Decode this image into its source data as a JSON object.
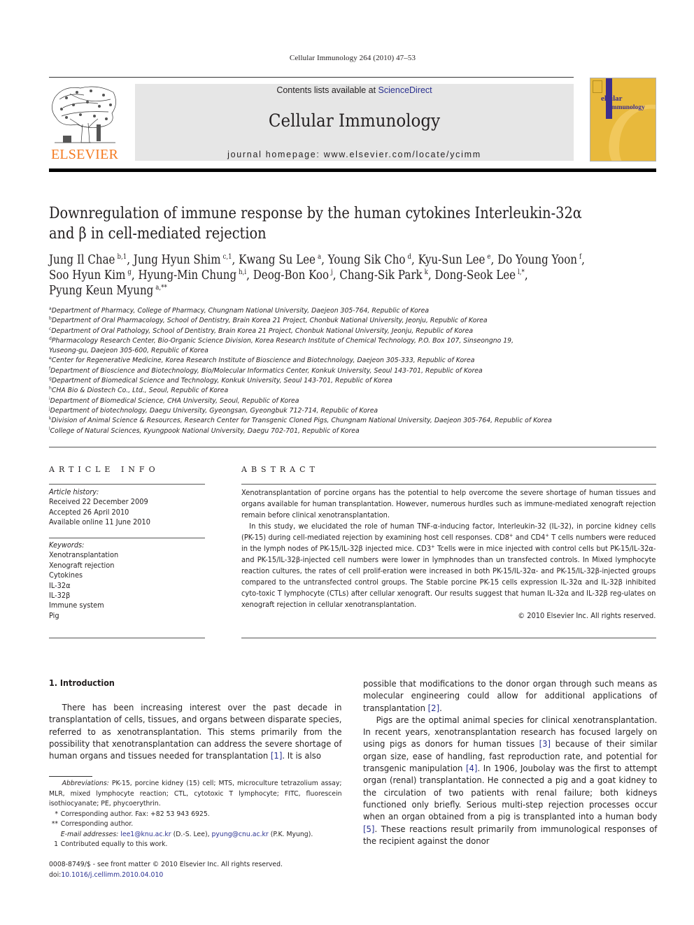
{
  "running_head": "Cellular Immunology 264 (2010) 47–53",
  "publisher": {
    "name": "ELSEVIER",
    "brand_color": "#f47a20"
  },
  "masthead": {
    "contents_prefix": "Contents lists available at ",
    "contents_link": "ScienceDirect",
    "journal_name": "Cellular Immunology",
    "homepage": "journal homepage: www.elsevier.com/locate/ycimm",
    "background": "#e6e6e6",
    "link_color": "#2a3190"
  },
  "cover": {
    "line1": "ellular",
    "line2": "Immunology",
    "big_letter": "C",
    "color": "#e8b93c",
    "accent": "#3c2f8e"
  },
  "article": {
    "title_line1": "Downregulation of immune response by the human cytokines Interleukin-32α",
    "title_line2": "and β in cell-mediated rejection",
    "authors": [
      {
        "name": "Jung Il Chae",
        "sup": "b,1"
      },
      {
        "name": "Jung Hyun Shim",
        "sup": "c,1"
      },
      {
        "name": "Kwang Su Lee",
        "sup": "a"
      },
      {
        "name": "Young Sik Cho",
        "sup": "d"
      },
      {
        "name": "Kyu-Sun Lee",
        "sup": "e"
      },
      {
        "name": "Do Young Yoon",
        "sup": "f"
      },
      {
        "name": "Soo Hyun Kim",
        "sup": "g"
      },
      {
        "name": "Hyung-Min Chung",
        "sup": "h,i"
      },
      {
        "name": "Deog-Bon Koo",
        "sup": "j"
      },
      {
        "name": "Chang-Sik Park",
        "sup": "k"
      },
      {
        "name": "Dong-Seok Lee",
        "sup": "l,*"
      },
      {
        "name": "Pyung Keun Myung",
        "sup": "a,**"
      }
    ],
    "affiliations": [
      {
        "key": "a",
        "text": "Department of Pharmacy, College of Pharmacy, Chungnam National University, Daejeon 305-764, Republic of Korea"
      },
      {
        "key": "b",
        "text": "Department of Oral Pharmacology, School of Dentistry, Brain Korea 21 Project, Chonbuk National University, Jeonju, Republic of Korea"
      },
      {
        "key": "c",
        "text": "Department of Oral Pathology, School of Dentistry, Brain Korea 21 Project, Chonbuk National University, Jeonju, Republic of Korea"
      },
      {
        "key": "d",
        "text": "Pharmacology Research Center, Bio-Organic Science Division, Korea Research Institute of Chemical Technology, P.O. Box 107, Sinseongno 19,",
        "cont": "Yuseong-gu, Daejeon 305-600, Republic of Korea"
      },
      {
        "key": "e",
        "text": "Center for Regenerative Medicine, Korea Research Institute of Bioscience and Biotechnology, Daejeon 305-333, Republic of Korea"
      },
      {
        "key": "f",
        "text": "Department of Bioscience and Biotechnology, Bio/Molecular Informatics Center, Konkuk University, Seoul 143-701, Republic of Korea"
      },
      {
        "key": "g",
        "text": "Department of Biomedical Science and Technology, Konkuk University, Seoul 143-701, Republic of Korea"
      },
      {
        "key": "h",
        "text": "CHA Bio & Diostech Co., Ltd., Seoul, Republic of Korea"
      },
      {
        "key": "i",
        "text": "Department of Biomedical Science, CHA University, Seoul, Republic of Korea"
      },
      {
        "key": "j",
        "text": "Department of biotechnology, Daegu University, Gyeongsan, Gyeongbuk 712-714, Republic of Korea"
      },
      {
        "key": "k",
        "text": "Division of Animal Science & Resources, Research Center for Transgenic Cloned Pigs, Chungnam National University, Daejeon 305-764, Republic of Korea"
      },
      {
        "key": "l",
        "text": "College of Natural Sciences, Kyungpook National University, Daegu 702-701, Republic of Korea"
      }
    ]
  },
  "article_info": {
    "heading": "ARTICLE INFO",
    "history_label": "Article history:",
    "history": [
      "Received 22 December 2009",
      "Accepted 26 April 2010",
      "Available online 11 June 2010"
    ],
    "keywords_label": "Keywords:",
    "keywords": [
      "Xenotransplantation",
      "Xenograft rejection",
      "Cytokines",
      "IL-32α",
      "IL-32β",
      "Immune system",
      "Pig"
    ]
  },
  "abstract": {
    "heading": "ABSTRACT",
    "p1": "Xenotransplantation of porcine organs has the potential to help overcome the severe shortage of human tissues and organs available for human transplantation. However, numerous hurdles such as immune-mediated xenograft rejection remain before clinical xenotransplantation.",
    "p2_a": "In this study, we elucidated the role of human TNF-α-inducing factor, Interleukin-32 (IL-32), in porcine kidney cells (PK-15) during cell-mediated rejection by examining host cell responses. CD8",
    "p2_b": " and CD4",
    "p2_c": " T cells numbers were reduced in the lymph nodes of PK-15/IL-32β injected mice. CD3",
    "p2_d": " Tcells were in mice injected with control cells but PK-15/IL-32α- and PK-15/IL-32β-injected cell numbers were lower in lymphnodes than un transfected controls. In Mixed lymphocyte reaction cultures, the rates of cell prolif-eration were increased in both PK-15/IL-32α- and PK-15/IL-32β-injected groups compared to the untransfected control groups. The Stable porcine PK-15 cells expression IL-32α and IL-32β inhibited cyto-toxic T lymphocyte (CTLs) after cellular xenograft. Our results suggest that human IL-32α and IL-32β reg-ulates on xenograft rejection in cellular xenotransplantation.",
    "plus": "+",
    "copyright": "© 2010 Elsevier Inc. All rights reserved."
  },
  "introduction": {
    "heading": "1. Introduction",
    "left_p1_a": "There has been increasing interest over the past decade in transplantation of cells, tissues, and organs between disparate species, referred to as xenotransplantation. This stems primarily from the possibility that xenotransplantation can address the severe shortage of human organs and tissues needed for transplantation ",
    "ref1": "[1]",
    "left_p1_b": ". It is also",
    "right_p1_a": "possible that modifications to the donor organ through such means as molecular engineering could allow for additional applications of transplantation ",
    "ref2": "[2]",
    "right_p1_b": ".",
    "right_p2_a": "Pigs are the optimal animal species for clinical xenotransplantation. In recent years, xenotransplantation research has focused largely on using pigs as donors for human tissues ",
    "ref3": "[3]",
    "right_p2_b": " because of their similar organ size, ease of handling, fast reproduction rate, and potential for transgenic manipulation ",
    "ref4": "[4]",
    "right_p2_c": ". In 1906, Joubolay was the first to attempt organ (renal) transplantation. He connected a pig and a goat kidney to the circulation of two patients with renal failure; both kidneys functioned only briefly. Serious multi-step rejection processes occur when an organ obtained from a pig is transplanted into a human body ",
    "ref5": "[5]",
    "right_p2_d": ". These reactions result primarily from immunological responses of the recipient against the donor"
  },
  "footnotes": {
    "abbrev_label": "Abbreviations:",
    "abbrev_text": " PK-15, porcine kidney (15) cell; MTS, microculture tetrazolium assay; MLR, mixed lymphocyte reaction; CTL, cytotoxic T lymphocyte; FITC, fluorescein isothiocyanate; PE, phycoerythrin.",
    "star1_mark": "*",
    "star1_text": "Corresponding author. Fax: +82 53 943 6925.",
    "star2_mark": "**",
    "star2_text": "Corresponding author.",
    "email_label": "E-mail addresses:",
    "email1": "lee1@knu.ac.kr",
    "email1_who": " (D.-S. Lee), ",
    "email2": "pyung@cnu.ac.kr",
    "email2_who": " (P.K. Myung).",
    "one_mark": "1",
    "one_text": "Contributed equally to this work.",
    "front_matter": "0008-8749/$ - see front matter © 2010 Elsevier Inc. All rights reserved.",
    "doi_prefix": "doi:",
    "doi": "10.1016/j.cellimm.2010.04.010"
  }
}
